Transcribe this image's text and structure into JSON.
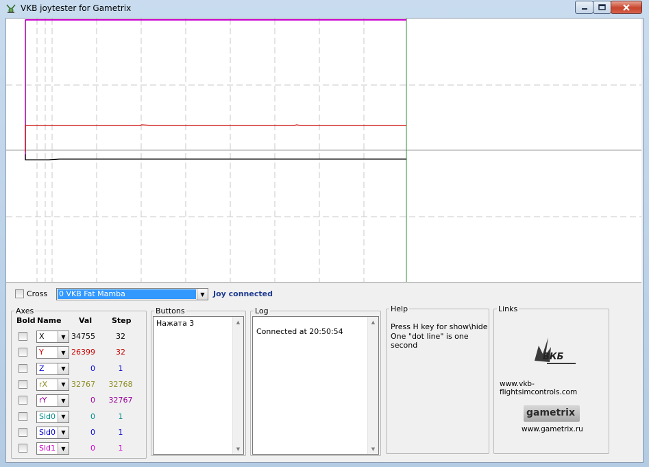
{
  "window": {
    "title": "VKB joytester for Gametrix"
  },
  "colors": {
    "x": "#000000",
    "y": "#cc0000",
    "z": "#0000cc",
    "rx": "#8a8a1e",
    "ry": "#990099",
    "sld0a": "#008b8b",
    "sld0b": "#0000cc",
    "sld1": "#cc00cc"
  },
  "controls": {
    "cross_label": "Cross",
    "device_select": "0 VKB Fat Mamba",
    "status": "Joy connected"
  },
  "axes": {
    "title": "Axes",
    "headers": {
      "bold": "Bold",
      "name": "Name",
      "val": "Val",
      "step": "Step"
    },
    "rows": [
      {
        "name": "X",
        "val": "34755",
        "step": "32"
      },
      {
        "name": "Y",
        "val": "26399",
        "step": "32"
      },
      {
        "name": "Z",
        "val": "0",
        "step": "1"
      },
      {
        "name": "rX",
        "val": "32767",
        "step": "32768"
      },
      {
        "name": "rY",
        "val": "0",
        "step": "32767"
      },
      {
        "name": "Sld0",
        "val": "0",
        "step": "1"
      },
      {
        "name": "Sld0",
        "val": "0",
        "step": "1"
      },
      {
        "name": "Sld1",
        "val": "0",
        "step": "1"
      }
    ]
  },
  "buttons": {
    "title": "Buttons",
    "items": [
      "Нажата 3"
    ]
  },
  "log": {
    "title": "Log",
    "items": [
      "Connected at 20:50:54"
    ]
  },
  "help": {
    "title": "Help",
    "line1": "Press H key for show\\hide",
    "line2": "One \"dot line\" is one second"
  },
  "links": {
    "title": "Links",
    "vkb_logo": "ВКБ",
    "vkb_url": "www.vkb-flightsimcontrols.com",
    "gametrix_logo": "gametrix",
    "gametrix_url": "www.gametrix.ru"
  },
  "icons": {
    "app": "joystick-icon",
    "minimize": "minimize-icon",
    "maximize": "maximize-icon",
    "close": "close-icon"
  }
}
